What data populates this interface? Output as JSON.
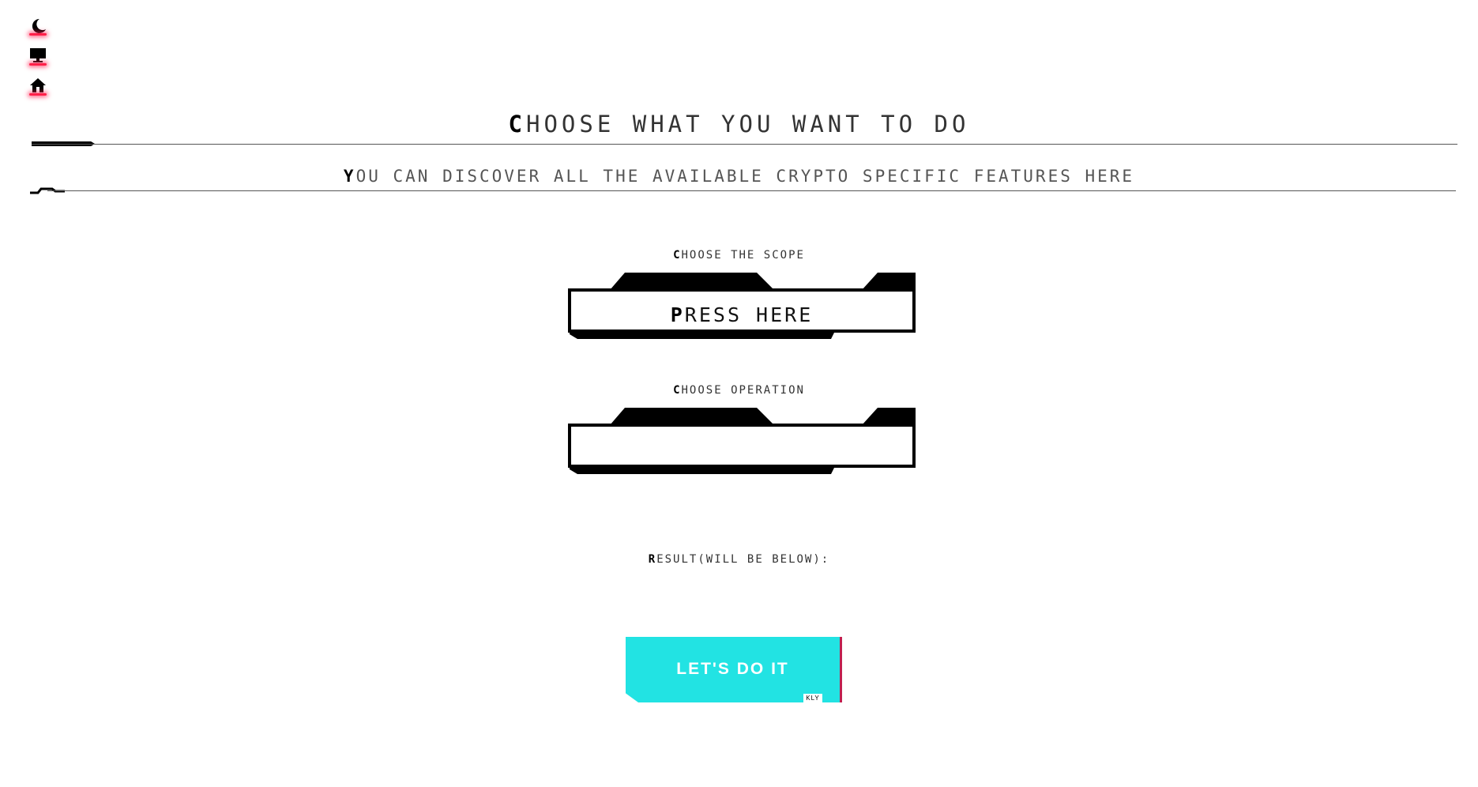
{
  "sidebar": {
    "icons": [
      {
        "name": "moon-icon"
      },
      {
        "name": "monitor-icon"
      },
      {
        "name": "home-icon"
      }
    ],
    "glow_color": "#ff1f48"
  },
  "header": {
    "title_first": "C",
    "title_rest": "HOOSE WHAT YOU WANT TO DO",
    "subtitle_first": "Y",
    "subtitle_rest": "OU CAN DISCOVER ALL THE AVAILABLE CRYPTO SPECIFIC FEATURES HERE"
  },
  "form": {
    "scope": {
      "label_first": "C",
      "label_rest": "HOOSE THE SCOPE",
      "value_first": "P",
      "value_rest": "RESS HERE"
    },
    "operation": {
      "label_first": "C",
      "label_rest": "HOOSE OPERATION",
      "value": ""
    },
    "result": {
      "label_first": "R",
      "label_rest": "ESULT(WILL BE BELOW):"
    }
  },
  "action": {
    "label": "LET'S DO IT",
    "tag": "KLY",
    "color": "#22e3e3",
    "accent": "#c02050"
  }
}
